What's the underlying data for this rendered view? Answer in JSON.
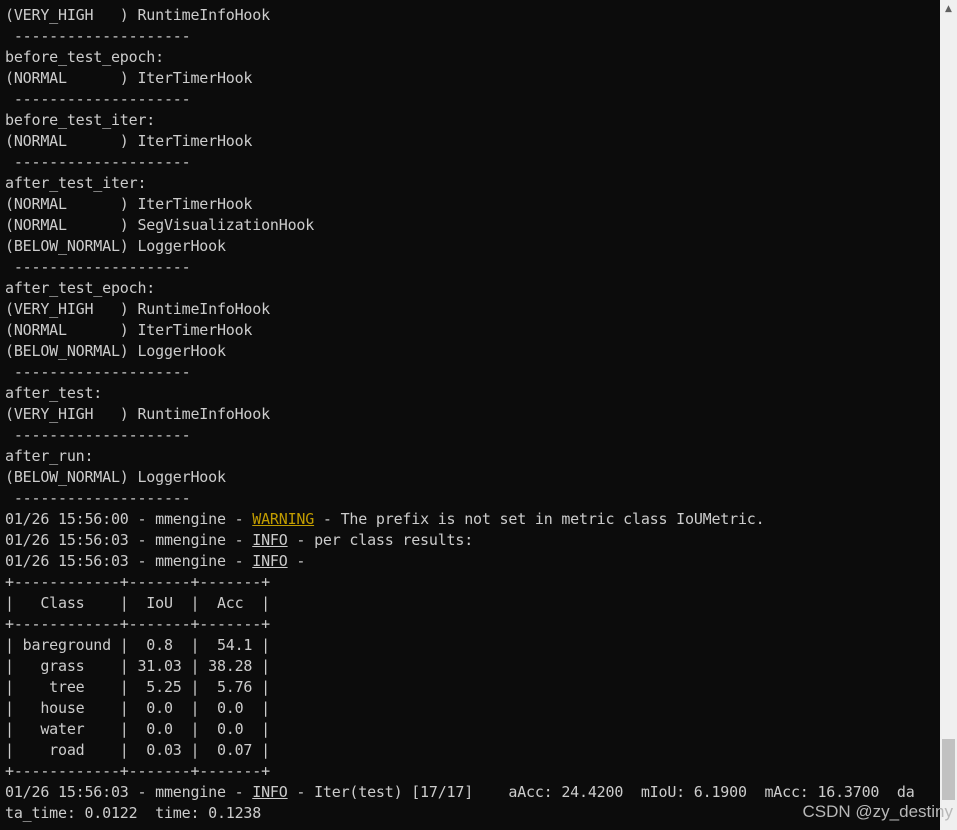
{
  "terminal": {
    "lines": [
      [
        {
          "t": "(VERY_HIGH   ) RuntimeInfoHook"
        }
      ],
      [
        {
          "t": " --------------------"
        }
      ],
      [
        {
          "t": "before_test_epoch:"
        }
      ],
      [
        {
          "t": "(NORMAL      ) IterTimerHook"
        }
      ],
      [
        {
          "t": " --------------------"
        }
      ],
      [
        {
          "t": "before_test_iter:"
        }
      ],
      [
        {
          "t": "(NORMAL      ) IterTimerHook"
        }
      ],
      [
        {
          "t": " --------------------"
        }
      ],
      [
        {
          "t": "after_test_iter:"
        }
      ],
      [
        {
          "t": "(NORMAL      ) IterTimerHook"
        }
      ],
      [
        {
          "t": "(NORMAL      ) SegVisualizationHook"
        }
      ],
      [
        {
          "t": "(BELOW_NORMAL) LoggerHook"
        }
      ],
      [
        {
          "t": " --------------------"
        }
      ],
      [
        {
          "t": "after_test_epoch:"
        }
      ],
      [
        {
          "t": "(VERY_HIGH   ) RuntimeInfoHook"
        }
      ],
      [
        {
          "t": "(NORMAL      ) IterTimerHook"
        }
      ],
      [
        {
          "t": "(BELOW_NORMAL) LoggerHook"
        }
      ],
      [
        {
          "t": " --------------------"
        }
      ],
      [
        {
          "t": "after_test:"
        }
      ],
      [
        {
          "t": "(VERY_HIGH   ) RuntimeInfoHook"
        }
      ],
      [
        {
          "t": " --------------------"
        }
      ],
      [
        {
          "t": "after_run:"
        }
      ],
      [
        {
          "t": "(BELOW_NORMAL) LoggerHook"
        }
      ],
      [
        {
          "t": " --------------------"
        }
      ],
      [
        {
          "t": "01/26 15:56:00 - mmengine - "
        },
        {
          "t": "WARNING",
          "c": "warn"
        },
        {
          "t": " - The prefix is not set in metric class IoUMetric."
        }
      ],
      [
        {
          "t": "01/26 15:56:03 - mmengine - "
        },
        {
          "t": "INFO",
          "c": "info"
        },
        {
          "t": " - per class results:"
        }
      ],
      [
        {
          "t": "01/26 15:56:03 - mmengine - "
        },
        {
          "t": "INFO",
          "c": "info"
        },
        {
          "t": " -"
        }
      ],
      [
        {
          "t": "+------------+-------+-------+"
        }
      ],
      [
        {
          "t": "|   Class    |  IoU  |  Acc  |"
        }
      ],
      [
        {
          "t": "+------------+-------+-------+"
        }
      ],
      [
        {
          "t": "| bareground |  0.8  |  54.1 |"
        }
      ],
      [
        {
          "t": "|   grass    | 31.03 | 38.28 |"
        }
      ],
      [
        {
          "t": "|    tree    |  5.25 |  5.76 |"
        }
      ],
      [
        {
          "t": "|   house    |  0.0  |  0.0  |"
        }
      ],
      [
        {
          "t": "|   water    |  0.0  |  0.0  |"
        }
      ],
      [
        {
          "t": "|    road    |  0.03 |  0.07 |"
        }
      ],
      [
        {
          "t": "+------------+-------+-------+"
        }
      ],
      [
        {
          "t": "01/26 15:56:03 - mmengine - "
        },
        {
          "t": "INFO",
          "c": "info"
        },
        {
          "t": " - Iter(test) [17/17]    aAcc: 24.4200  mIoU: 6.1900  mAcc: 16.3700  da"
        }
      ],
      [
        {
          "t": "ta_time: 0.0122  time: 0.1238"
        }
      ]
    ]
  },
  "scrollbar": {
    "up_arrow_icon": "chevron-up-icon",
    "up_arrow_glyph": "▲",
    "position": 0.96
  },
  "watermark": {
    "text": "CSDN @zy_destiny"
  }
}
